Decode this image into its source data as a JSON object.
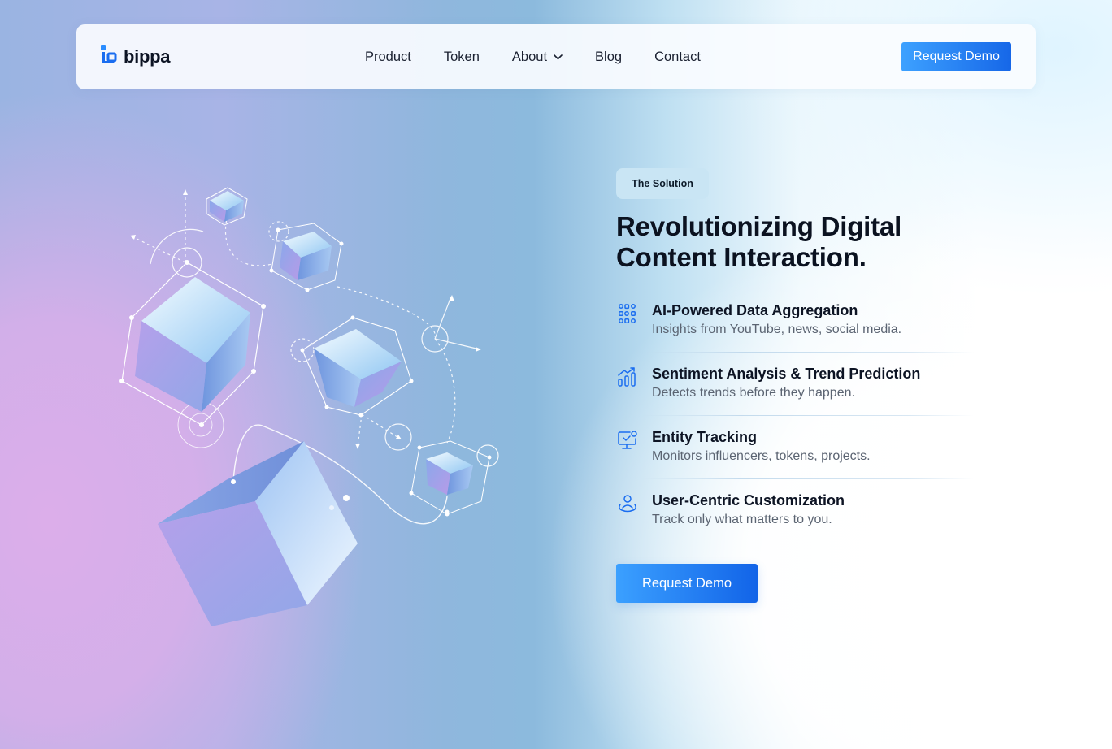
{
  "brand": {
    "name": "bippa",
    "logo_icon": "bippa-logo-icon",
    "accent": "#1a6df0"
  },
  "nav": {
    "items": [
      {
        "label": "Product"
      },
      {
        "label": "Token"
      },
      {
        "label": "About",
        "has_dropdown": true
      },
      {
        "label": "Blog"
      },
      {
        "label": "Contact"
      }
    ],
    "cta_label": "Request Demo"
  },
  "hero": {
    "badge": "The Solution",
    "headline_line1": "Revolutionizing Digital",
    "headline_line2": "Content Interaction.",
    "features": [
      {
        "icon": "data-grid-icon",
        "title": "AI-Powered Data Aggregation",
        "description": "Insights from YouTube, news, social media."
      },
      {
        "icon": "trend-chart-icon",
        "title": "Sentiment Analysis & Trend Prediction",
        "description": "Detects trends before they happen."
      },
      {
        "icon": "monitor-tracking-icon",
        "title": "Entity Tracking",
        "description": "Monitors influencers, tokens, projects."
      },
      {
        "icon": "user-custom-icon",
        "title": "User-Centric Customization",
        "description": "Track only what matters to you."
      }
    ],
    "cta_label": "Request Demo"
  },
  "colors": {
    "button_gradient_start": "#3da1ff",
    "button_gradient_end": "#1667e8",
    "badge_bg": "#c9e5f4",
    "heading": "#0b1220",
    "body_text": "#5b6472"
  }
}
